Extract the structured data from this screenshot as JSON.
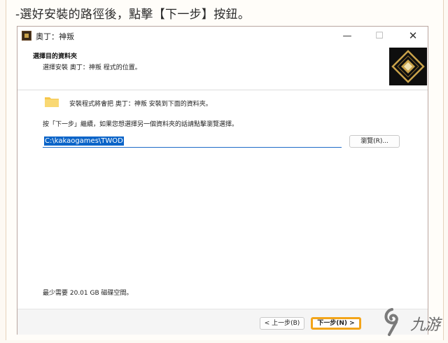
{
  "caption": "-選好安裝的路徑後，點擊【下一步】按鈕。",
  "window": {
    "title": "奧丁：神叛",
    "controls": {
      "minimize": "—",
      "maximize": "☐",
      "close": "✕"
    }
  },
  "header": {
    "title": "選擇目的資料夾",
    "subtitle": "選擇安裝 奧丁：神叛 程式的位置。"
  },
  "body": {
    "folder_message": "安裝程式將會把 奧丁：神叛 安裝到下面的資料夾。",
    "instruction": "按「下一步」繼續，如果您想選擇另一個資料夾的話請點擊瀏覽選擇。",
    "path_value": "C:\\kakaogames\\TWOD",
    "browse_label": "瀏覽(R)...",
    "space_required": "最少需要 20.01 GB 磁碟空間。"
  },
  "footer": {
    "back_label": "< 上一步(B)",
    "next_label": "下一步(N) >"
  },
  "watermark": {
    "text": "九游"
  },
  "colors": {
    "highlight": "#f3a51a",
    "selection": "#0a64c8",
    "logo_gold": "#c9a24a"
  },
  "icons": [
    "app-icon",
    "folder-icon",
    "game-logo",
    "watermark-logo"
  ]
}
